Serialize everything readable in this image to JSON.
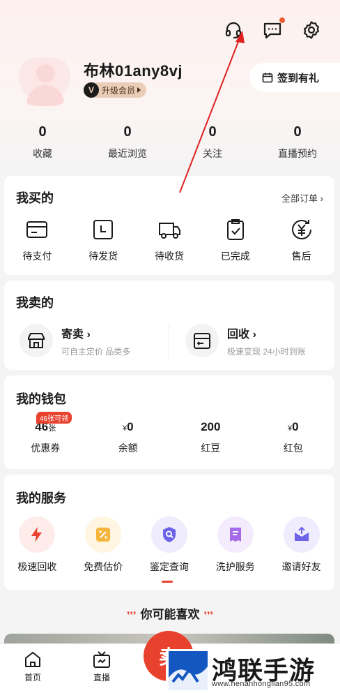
{
  "profile": {
    "username": "布林01any8vj",
    "vip_label": "升级会员",
    "vip_icon_letter": "V",
    "checkin_label": "签到有礼"
  },
  "top_icons": [
    "headset-icon",
    "message-icon",
    "settings-icon"
  ],
  "stats": [
    {
      "value": "0",
      "label": "收藏"
    },
    {
      "value": "0",
      "label": "最近浏览"
    },
    {
      "value": "0",
      "label": "关注"
    },
    {
      "value": "0",
      "label": "直播预约"
    }
  ],
  "buy": {
    "title": "我买的",
    "all_orders": "全部订单 ›",
    "items": [
      {
        "label": "待支付",
        "icon": "wallet-card-icon"
      },
      {
        "label": "待发货",
        "icon": "box-clock-icon"
      },
      {
        "label": "待收货",
        "icon": "truck-icon"
      },
      {
        "label": "已完成",
        "icon": "clipboard-check-icon"
      },
      {
        "label": "售后",
        "icon": "yen-refresh-icon"
      }
    ]
  },
  "sell": {
    "title": "我卖的",
    "consign": {
      "title": "寄卖 ›",
      "subtitle": "可自主定价 品类多"
    },
    "recycle": {
      "title": "回收 ›",
      "subtitle": "极速变现 24小时到账"
    }
  },
  "wallet": {
    "title": "我的钱包",
    "coupon_tag": "46张可领",
    "items": [
      {
        "value": "46",
        "unit": "张",
        "label": "优惠券"
      },
      {
        "value": "0",
        "prefix": "¥",
        "label": "余额"
      },
      {
        "value": "200",
        "label": "红豆"
      },
      {
        "value": "0",
        "prefix": "¥",
        "label": "红包"
      }
    ]
  },
  "services": {
    "title": "我的服务",
    "items": [
      {
        "label": "极速回收",
        "color": "#e8412d",
        "bg": "#fdecea"
      },
      {
        "label": "免费估价",
        "color": "#f5b43c",
        "bg": "#fff5e0"
      },
      {
        "label": "鉴定查询",
        "color": "#6c63e8",
        "bg": "#eeecfd"
      },
      {
        "label": "洗护服务",
        "color": "#a66be8",
        "bg": "#f4ecfd"
      },
      {
        "label": "邀请好友",
        "color": "#6c63e8",
        "bg": "#eeecfd"
      }
    ]
  },
  "recommend_title": "你可能喜欢",
  "recommend_deco": "❜❜❜",
  "tabbar": {
    "home": "首页",
    "live": "直播",
    "sell_button": "卖"
  },
  "watermark": {
    "text": "鸿联手游网",
    "url": "www.henanhonglian95.com"
  },
  "colors": {
    "accent": "#e8412d",
    "vip_gold": "#e9cdb6"
  }
}
